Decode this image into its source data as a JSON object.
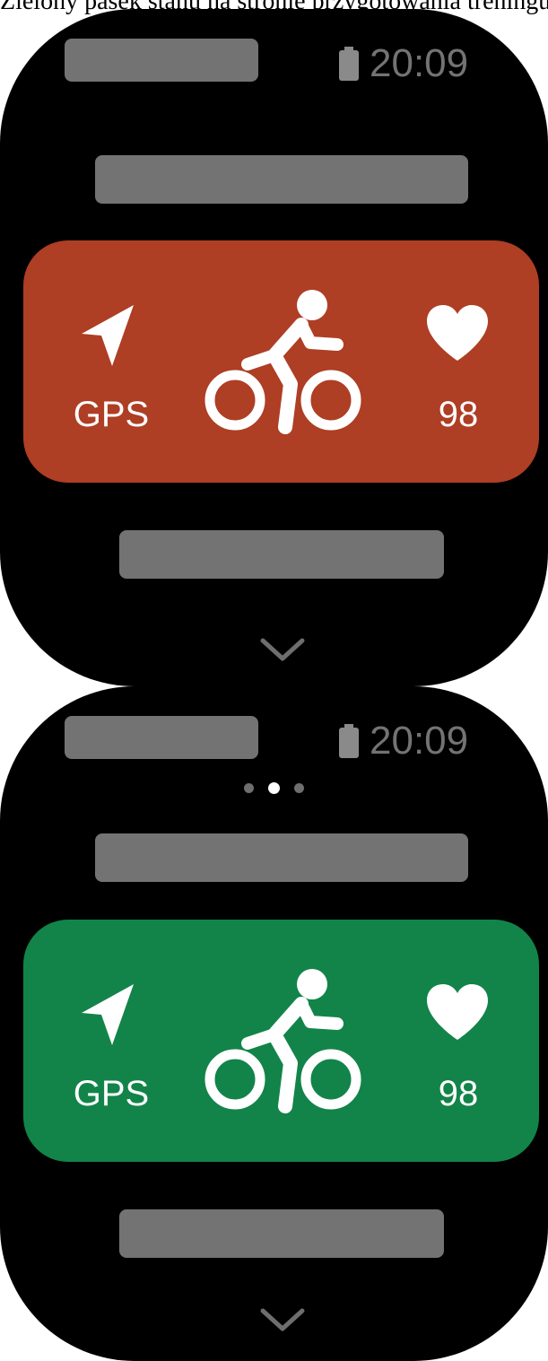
{
  "caption": "Zielony pasek stanu na stronie przygotowania treningu",
  "screens": [
    {
      "time": "20:09",
      "card": {
        "gps_label": "GPS",
        "heart_rate": "98",
        "color": "#ae3e24"
      }
    },
    {
      "time": "20:09",
      "pagination": {
        "count": 3,
        "active": 2
      },
      "card": {
        "gps_label": "GPS",
        "heart_rate": "98",
        "color": "#128449"
      }
    }
  ],
  "icons": {
    "gps": "navigation-arrow-icon",
    "activity": "cycling-icon",
    "heart_rate": "heart-icon",
    "more": "chevron-down-icon",
    "battery": "battery-icon"
  },
  "colors": {
    "placeholder": "#737373",
    "screen_background": "#000000",
    "text": "#ffffff"
  }
}
